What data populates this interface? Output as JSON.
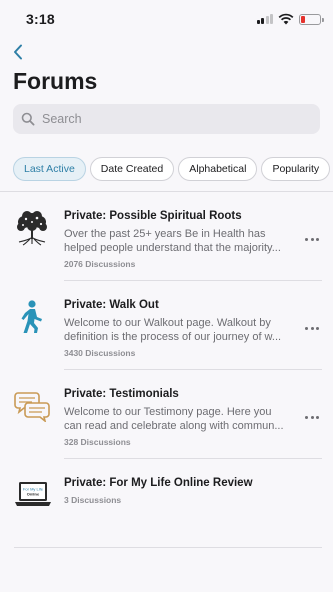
{
  "status_bar": {
    "time": "3:18"
  },
  "header": {
    "title": "Forums"
  },
  "search": {
    "placeholder": "Search"
  },
  "filters": [
    {
      "label": "Last Active",
      "active": true
    },
    {
      "label": "Date Created",
      "active": false
    },
    {
      "label": "Alphabetical",
      "active": false
    },
    {
      "label": "Popularity",
      "active": false
    }
  ],
  "forums": [
    {
      "title": "Private: Possible Spiritual Roots",
      "description": "Over the past 25+ years Be in Health has helped people understand that the majority...",
      "count": "2076 Discussions",
      "icon": "tree-icon"
    },
    {
      "title": "Private: Walk Out",
      "description": "Welcome to our Walkout page. Walkout by definition is the process of our journey of w...",
      "count": "3430 Discussions",
      "icon": "walking-person-icon"
    },
    {
      "title": "Private: Testimonials",
      "description": "Welcome to our Testimony page. Here you can read and celebrate along with commun...",
      "count": "328 Discussions",
      "icon": "speech-bubbles-icon"
    },
    {
      "title": "Private: For My Life Online Review",
      "description": "",
      "count": "3 Discussions",
      "icon": "laptop-icon",
      "icon_text": "For My Life Online"
    }
  ],
  "colors": {
    "accent": "#2e7fa6",
    "walker": "#2a93b8",
    "bubbles": "#c99a55",
    "battery": "#e5322d"
  }
}
